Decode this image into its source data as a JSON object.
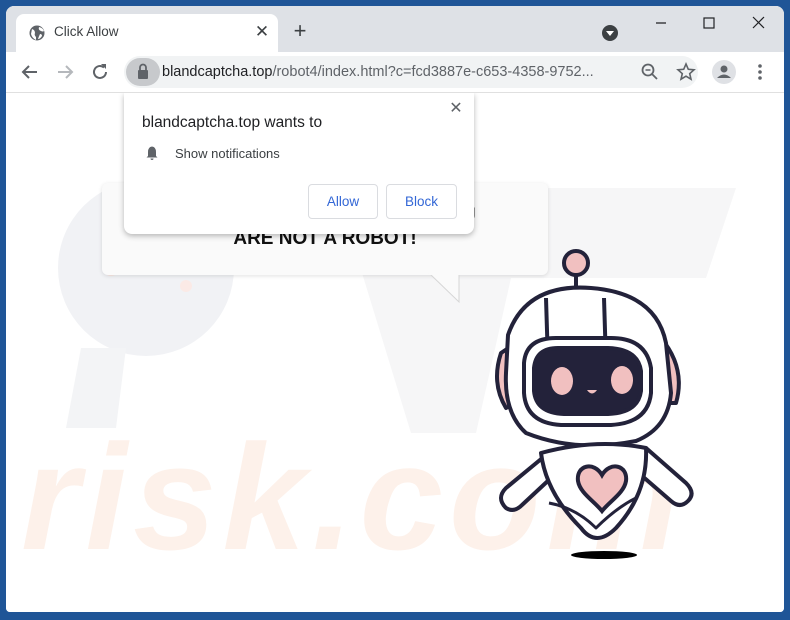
{
  "browser": {
    "tab": {
      "title": "Click Allow",
      "favicon": "globe-icon"
    },
    "new_tab_symbol": "+",
    "tab_close_symbol": "✕",
    "window_controls": {
      "minimize": "—",
      "maximize": "☐",
      "close": "✕"
    },
    "address": {
      "domain": "blandcaptcha.top",
      "path": "/robot4/index.html?c=fcd3887e-c653-4358-9752..."
    }
  },
  "permission_prompt": {
    "origin_text": "blandcaptcha.top wants to",
    "permission_label": "Show notifications",
    "allow_label": "Allow",
    "block_label": "Block",
    "close_symbol": "✕"
  },
  "page": {
    "bubble_line1_visible": "YOU",
    "bubble_line2": "ARE NOT A ROBOT!",
    "watermark": "risk.com",
    "colors": {
      "robot_outline": "#23223a",
      "robot_pink": "#f1c0c0",
      "link_blue": "#3367d6"
    }
  }
}
